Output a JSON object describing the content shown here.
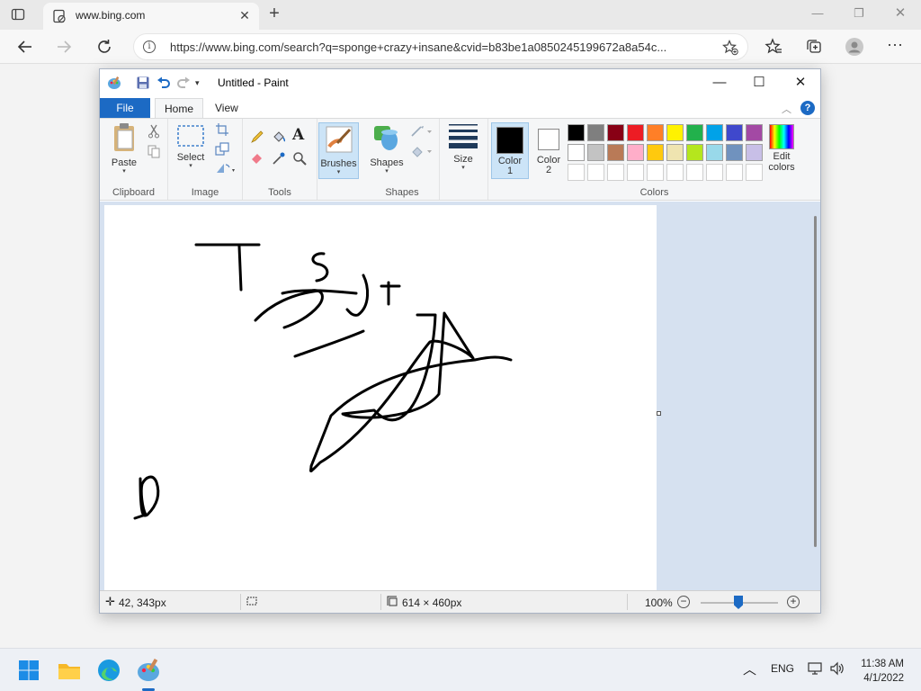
{
  "browser": {
    "tab_title": "www.bing.com",
    "url": "https://www.bing.com/search?q=sponge+crazy+insane&cvid=b83be1a0850245199672a8a54c...",
    "new_tab_symbol": "+",
    "close_symbol": "✕"
  },
  "paint": {
    "window_title": "Untitled - Paint",
    "tabs": {
      "file": "File",
      "home": "Home",
      "view": "View"
    },
    "groups": {
      "clipboard": "Clipboard",
      "image": "Image",
      "tools": "Tools",
      "shapes": "Shapes",
      "colors": "Colors"
    },
    "buttons": {
      "paste": "Paste",
      "select": "Select",
      "brushes": "Brushes",
      "shapes": "Shapes",
      "size": "Size",
      "color1_line1": "Color",
      "color1_line2": "1",
      "color2_line1": "Color",
      "color2_line2": "2",
      "edit_colors_line1": "Edit",
      "edit_colors_line2": "colors"
    },
    "palette_row1": [
      "#000000",
      "#7f7f7f",
      "#880015",
      "#ed1c24",
      "#ff7f27",
      "#fff200",
      "#22b14c",
      "#00a2e8",
      "#3f48cc",
      "#a349a4"
    ],
    "palette_row2": [
      "#ffffff",
      "#c3c3c3",
      "#b97a57",
      "#ffaec9",
      "#ffc90e",
      "#efe4b0",
      "#b5e61d",
      "#99d9ea",
      "#7092be",
      "#c8bfe7"
    ],
    "color1": "#000000",
    "color2": "#ffffff",
    "status": {
      "cursor_pos": "42, 343px",
      "canvas_size": "614 × 460px",
      "zoom": "100%"
    }
  },
  "taskbar": {
    "language": "ENG",
    "time": "11:38 AM",
    "date": "4/1/2022"
  },
  "colors": {
    "accent": "#1c6ac4",
    "workspace": "#d6e1f0"
  }
}
